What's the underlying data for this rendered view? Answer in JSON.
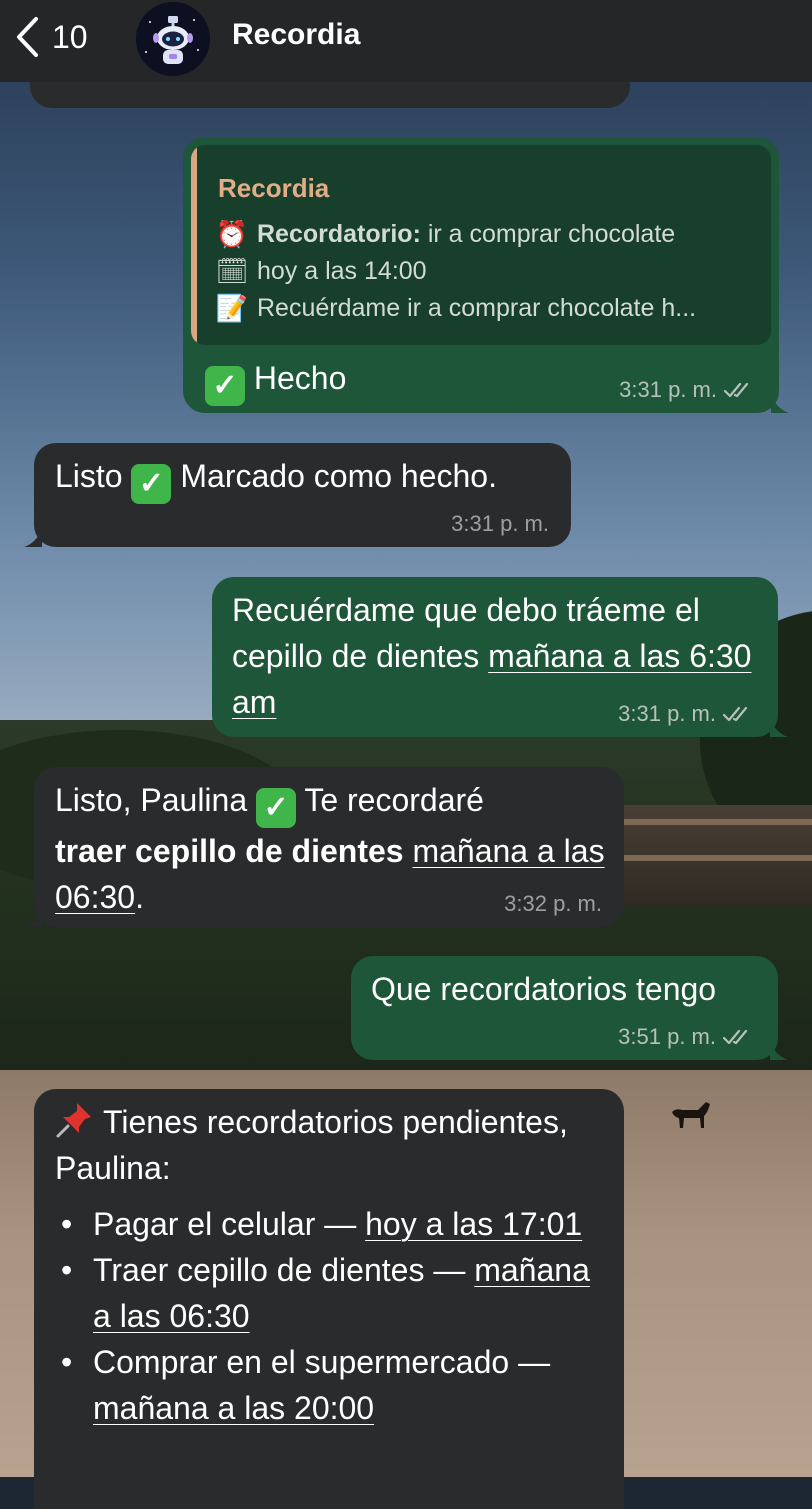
{
  "header": {
    "back_count": "10",
    "title": "Recordia",
    "back_icon": "chevron-left-icon",
    "avatar_icon": "robot-avatar-icon"
  },
  "messages": [
    {
      "type": "outgoing",
      "quote": {
        "author": "Recordia",
        "lines": [
          {
            "icon": "alarm-clock-icon",
            "emoji": "⏰",
            "bold": "Recordatorio:",
            "text": " ir a comprar chocolate"
          },
          {
            "icon": "calendar-icon",
            "emoji": "🗓",
            "bold": "",
            "text": "hoy a las 14:00"
          },
          {
            "icon": "memo-icon",
            "emoji": "📝",
            "bold": "",
            "text": "Recuérdame ir a comprar chocolate h..."
          }
        ]
      },
      "text": "Hecho",
      "time": "3:31 p. m."
    },
    {
      "type": "incoming",
      "text_before": "Listo",
      "text_after": "Marcado como hecho.",
      "time": "3:31 p. m."
    },
    {
      "type": "outgoing",
      "text_plain": "Recuérdame que debo tráeme el cepillo de dientes ",
      "text_link": "mañana a las 6:30 am",
      "time": "3:31 p. m."
    },
    {
      "type": "incoming",
      "text_before": "Listo, Paulina",
      "text_after": " Te recordaré",
      "bold": "traer cepillo de dientes",
      "link": "mañana a las 06:30",
      "end": ".",
      "time": "3:32 p. m."
    },
    {
      "type": "outgoing",
      "text": "Que recordatorios tengo",
      "time": "3:51 p. m."
    },
    {
      "type": "incoming",
      "intro": "Tienes recordatorios pendientes, Paulina:",
      "intro_icon": "pushpin-icon",
      "items": [
        {
          "title": "Pagar el celular — ",
          "when": "hoy a las 17:01"
        },
        {
          "title": "Traer cepillo de dientes — ",
          "when": "mañana a las 06:30"
        },
        {
          "title": "Comprar en el supermercado — ",
          "when": "mañana a las 20:00"
        }
      ]
    }
  ],
  "colors": {
    "header_bg": "#242628",
    "incoming_bubble": "#2a2b2c",
    "outgoing_bubble": "#1d5638",
    "quote_bg": "#173f2c",
    "quote_accent": "#d8a883",
    "check_green": "#3fb54a"
  }
}
